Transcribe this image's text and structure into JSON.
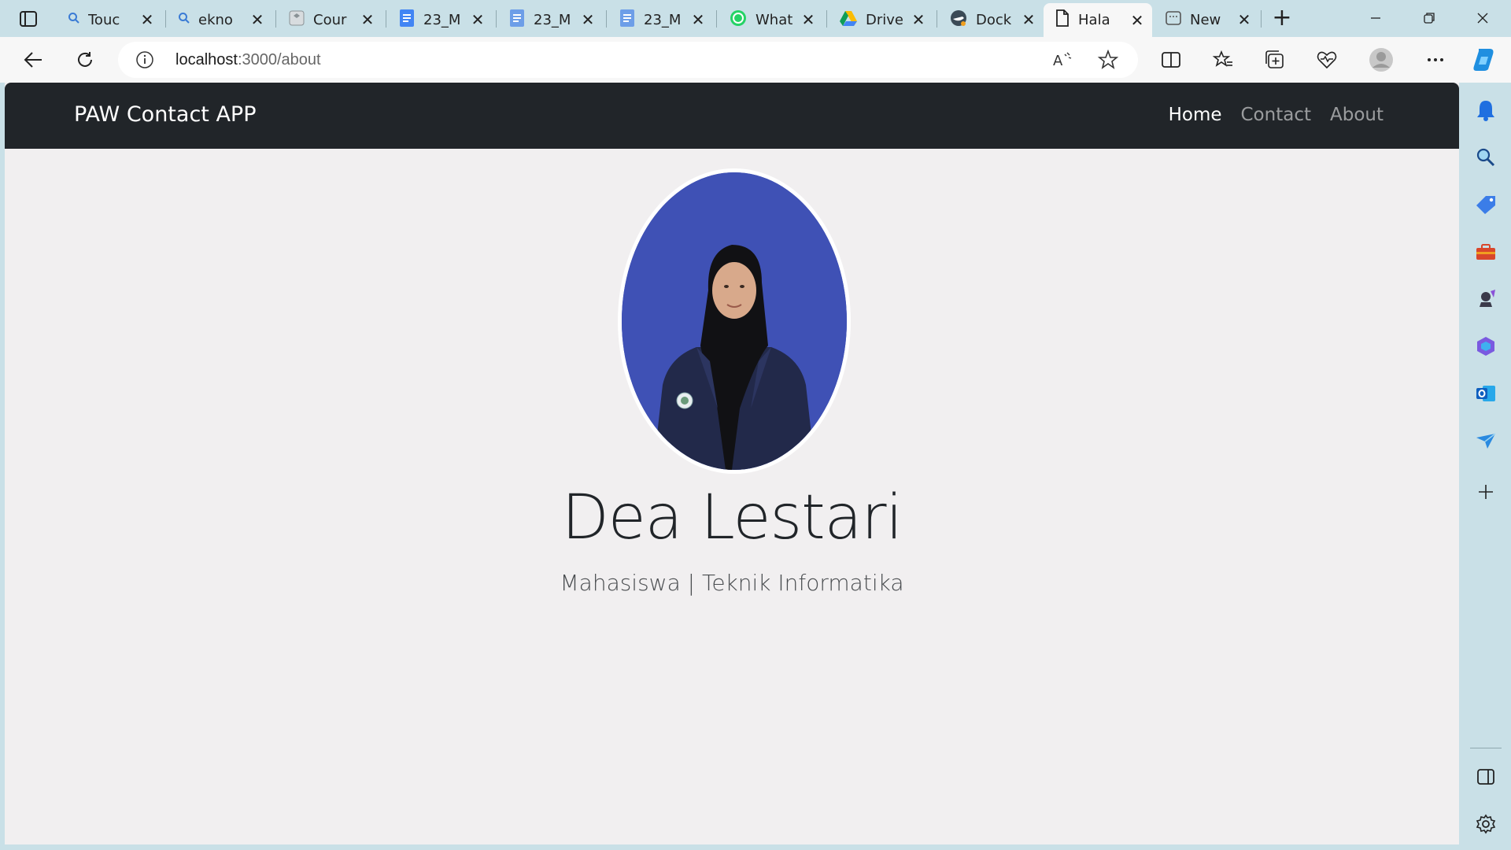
{
  "browser": {
    "tabs": [
      {
        "title": "Touc",
        "icon": "search-icon"
      },
      {
        "title": "ekno",
        "icon": "search-icon"
      },
      {
        "title": "Cour",
        "icon": "course-icon"
      },
      {
        "title": "23_M",
        "icon": "docs-icon"
      },
      {
        "title": "23_M",
        "icon": "docs-icon"
      },
      {
        "title": "23_M",
        "icon": "docs-icon"
      },
      {
        "title": "What",
        "icon": "whatsapp-icon"
      },
      {
        "title": "Drive",
        "icon": "drive-icon"
      },
      {
        "title": "Dock",
        "icon": "docker-icon"
      },
      {
        "title": "Hala",
        "icon": "page-icon",
        "active": true
      },
      {
        "title": "New",
        "icon": "newtab-icon"
      }
    ],
    "address": {
      "host": "localhost",
      "rest": ":3000/about"
    },
    "accent": "#c9e0e7"
  },
  "page": {
    "brand": "PAW Contact APP",
    "nav": [
      {
        "label": "Home",
        "active": true
      },
      {
        "label": "Contact",
        "active": false
      },
      {
        "label": "About",
        "active": false
      }
    ],
    "profile": {
      "name": "Dea Lestari",
      "subtitle": "Mahasiswa | Teknik Informatika",
      "photo_bg": "#3f51b5"
    },
    "colors": {
      "navbar": "#212529",
      "background": "#f1eff0"
    }
  }
}
